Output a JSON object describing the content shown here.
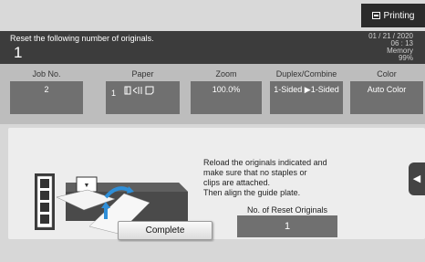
{
  "status": {
    "label": "Printing",
    "icon": "printer-icon"
  },
  "header": {
    "message": "Reset the following number of originals.",
    "count": "1",
    "date": "01 / 21 / 2020",
    "time": "06 : 13",
    "memory_label": "Memory",
    "memory_value": "99%"
  },
  "settings": {
    "job_no": {
      "label": "Job No.",
      "value": "2"
    },
    "paper": {
      "label": "Paper",
      "value": "1",
      "icons": "paper-tray-and-size-icons"
    },
    "zoom": {
      "label": "Zoom",
      "value": "100.0%"
    },
    "duplex": {
      "label": "Duplex/Combine",
      "value": "1-Sided ▶1-Sided"
    },
    "color": {
      "label": "Color",
      "value": "Auto Color"
    }
  },
  "instructions": {
    "line1": "Reload the originals indicated and",
    "line2": "make sure that no staples or",
    "line3": "clips are attached.",
    "line4": "Then align the guide plate."
  },
  "reset_originals": {
    "label": "No. of Reset Originals",
    "value": "1"
  },
  "buttons": {
    "complete": "Complete"
  },
  "colors": {
    "header_bg": "#3c3c3c",
    "value_box": "#707070",
    "accent_arrow": "#2f8fd8"
  }
}
